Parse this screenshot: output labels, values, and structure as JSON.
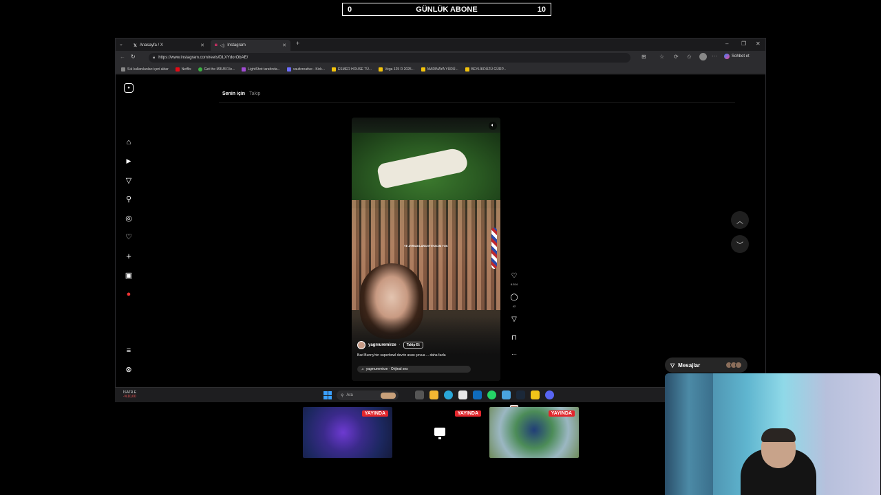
{
  "overlay": {
    "sub_goal": {
      "left": "0",
      "title": "GÜNLÜK ABONE",
      "right": "10"
    }
  },
  "browser": {
    "tabs": [
      {
        "label": "Anasayfa / X"
      },
      {
        "label": "Instagram"
      }
    ],
    "url": "https://www.instagram.com/reels/DLXYdorObAE/",
    "profile_label": "Sohbet et",
    "bookmarks": [
      "Sık kullanılanları içeri aktar",
      "Netflix",
      "Get the M3U8 File...",
      "LightShot tarafında...",
      "vaultcreative - Kick...",
      "ESMER HOUSE TÜ...",
      "Vega 125 R 2025...",
      "MARINAYA YÜRÜ...",
      "BEYLİKDÜZÜ GÜRP..."
    ]
  },
  "instagram": {
    "feed_tabs": {
      "active": "Senin için",
      "other": "Takip"
    },
    "reel": {
      "overlay_text": "VE AYRILIKLARA İHTİYACIM YOK",
      "username": "yagmuremirze",
      "follow_label": "Takip Et",
      "description": "Bad Bunny'nin superbowl devrin arası şovua ... daha fazla",
      "audio": "yagmuremirze · Orijinal ses",
      "likes": "6.514",
      "comments": "42"
    },
    "messages_label": "Mesajlar"
  },
  "taskbar": {
    "left_title": "İSATR.E",
    "left_sub": "-%10,00",
    "search_placeholder": "Ara"
  },
  "streams": {
    "live_label": "YAYINDA"
  },
  "colors": {
    "accent_red": "#e3262c",
    "bg": "#000000"
  }
}
